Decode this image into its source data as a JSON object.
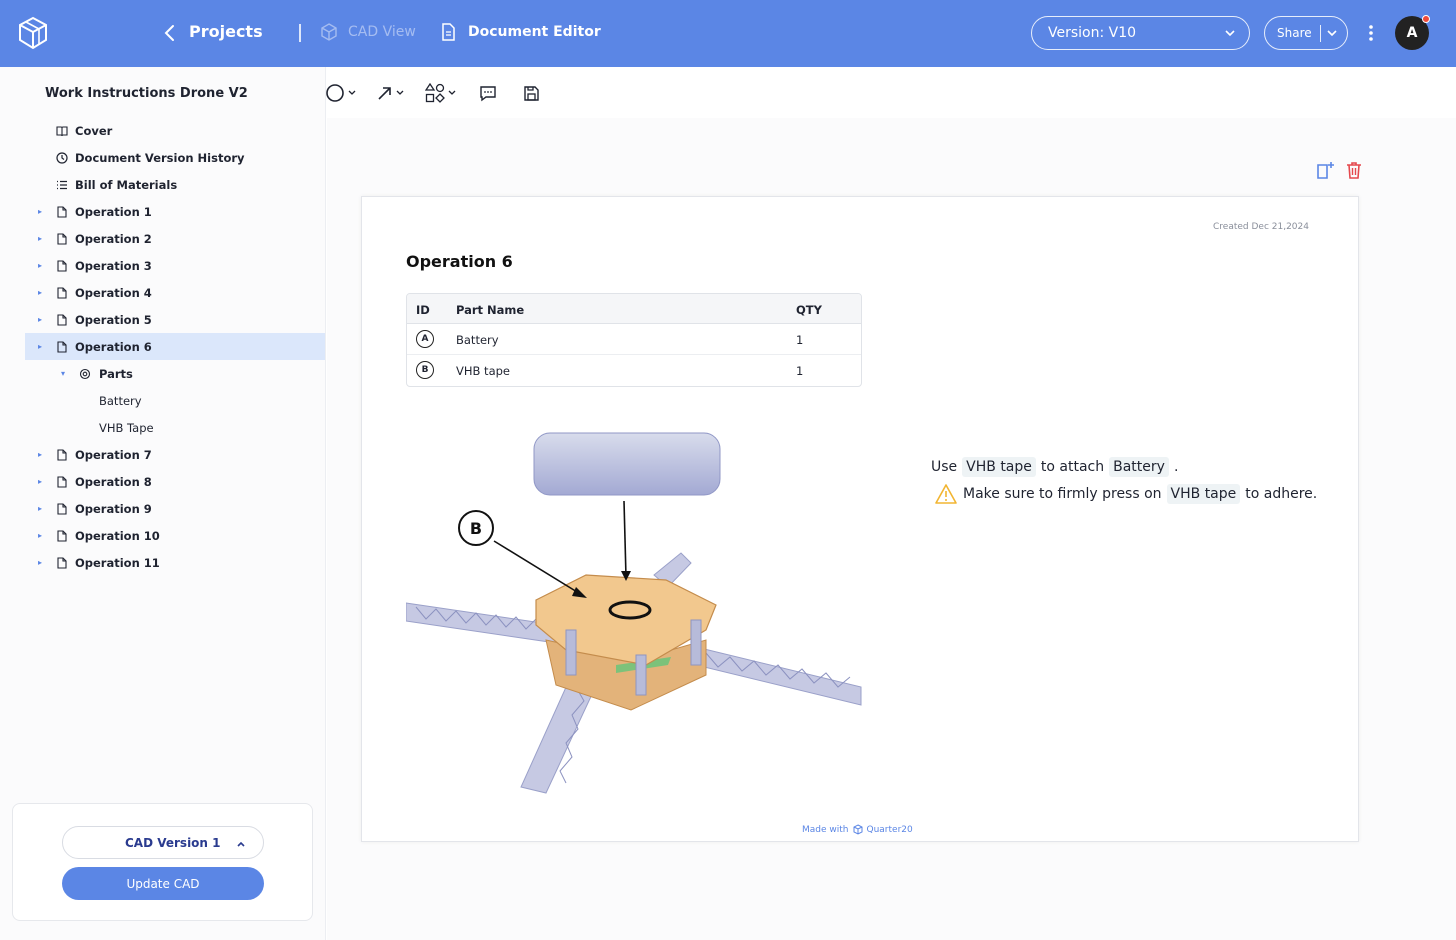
{
  "header": {
    "projects_label": "Projects",
    "cad_view_label": "CAD View",
    "document_editor_label": "Document Editor",
    "version_label": "Version: V10",
    "share_label": "Share",
    "avatar_initial": "A"
  },
  "sidebar": {
    "title": "Work Instructions Drone V2",
    "items": [
      {
        "label": "Cover"
      },
      {
        "label": "Document Version History"
      },
      {
        "label": "Bill of Materials"
      },
      {
        "label": "Operation 1"
      },
      {
        "label": "Operation 2"
      },
      {
        "label": "Operation 3"
      },
      {
        "label": "Operation 4"
      },
      {
        "label": "Operation 5"
      },
      {
        "label": "Operation 6"
      },
      {
        "label": "Parts"
      },
      {
        "label": "Battery"
      },
      {
        "label": "VHB Tape"
      },
      {
        "label": "Operation 7"
      },
      {
        "label": "Operation 8"
      },
      {
        "label": "Operation 9"
      },
      {
        "label": "Operation 10"
      },
      {
        "label": "Operation 11"
      }
    ],
    "cad_version_label": "CAD Version 1",
    "update_cad_label": "Update CAD"
  },
  "page": {
    "created": "Created Dec 21,2024",
    "title": "Operation 6",
    "table": {
      "headers": [
        "ID",
        "Part Name",
        "QTY"
      ],
      "rows": [
        {
          "id": "A",
          "name": "Battery",
          "qty": "1"
        },
        {
          "id": "B",
          "name": "VHB tape",
          "qty": "1"
        }
      ]
    },
    "callout_label": "B",
    "instruction": {
      "use": "Use",
      "part1": "VHB tape",
      "to_attach": "to attach",
      "part2": "Battery",
      "period": "."
    },
    "warning": {
      "make_sure": "Make sure to firmly press on",
      "part": "VHB tape",
      "to_adhere": "to adhere."
    },
    "made_with": "Made with",
    "brand": "Quarter20"
  },
  "colors": {
    "accent": "#5b86e5",
    "active_row": "#dbe7fb",
    "warning": "#f2b532",
    "delete": "#e5484d"
  }
}
